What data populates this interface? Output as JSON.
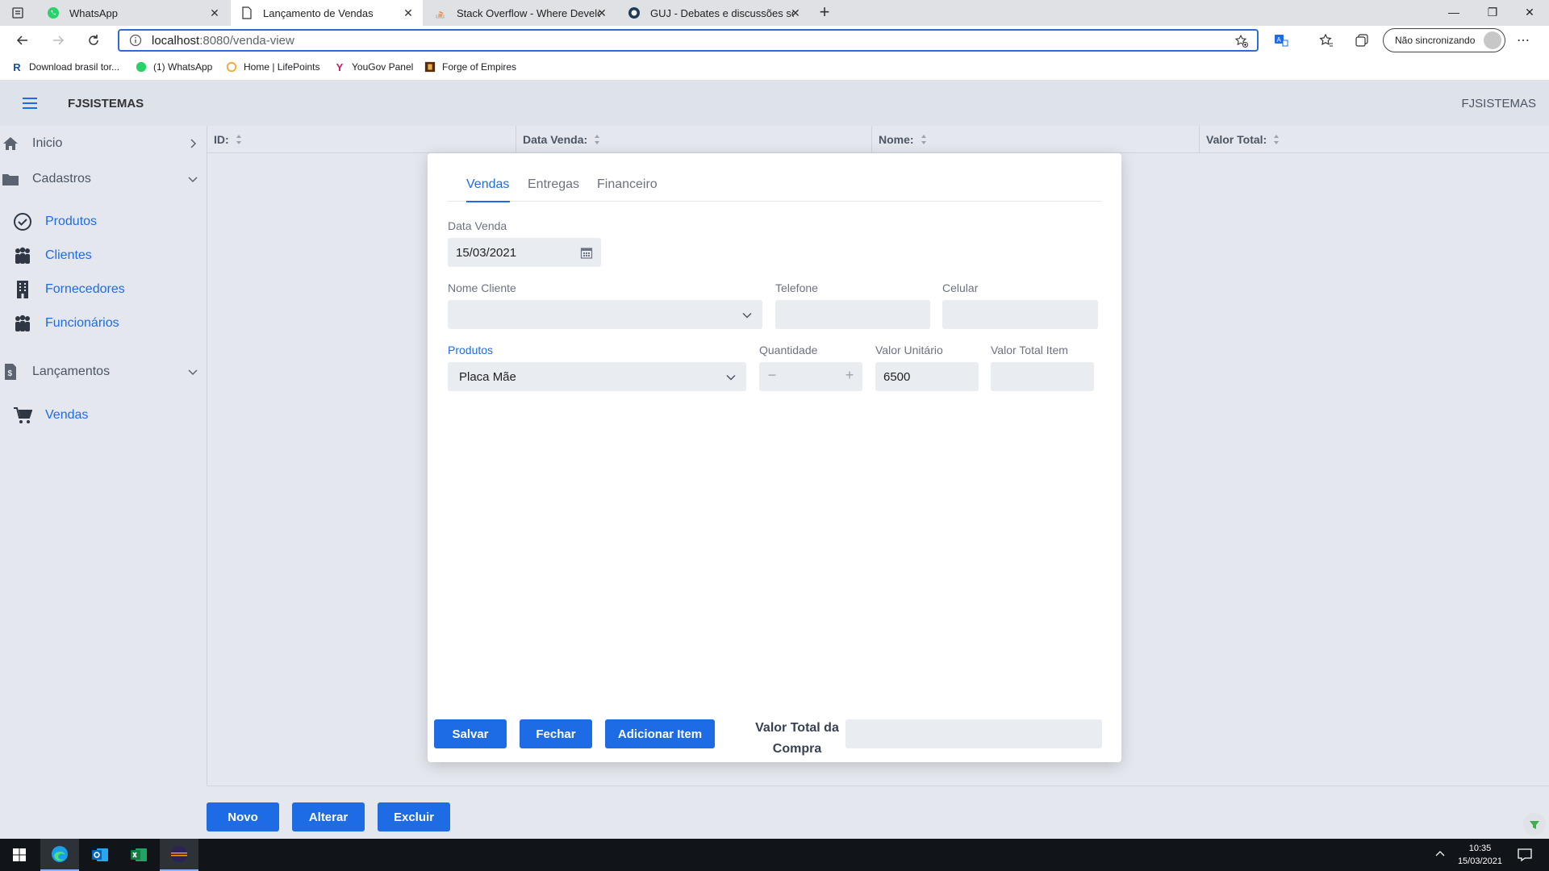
{
  "browser": {
    "tabs": [
      {
        "title": "WhatsApp",
        "active": false
      },
      {
        "title": "Lançamento de Vendas",
        "active": true
      },
      {
        "title": "Stack Overflow - Where Developer",
        "active": false
      },
      {
        "title": "GUJ - Debates e discussões sobre",
        "active": false
      }
    ],
    "url_host": "localhost",
    "url_path": ":8080/venda-view",
    "sync_label": "Não sincronizando",
    "bookmarks": [
      {
        "label": "Download brasil tor..."
      },
      {
        "label": "(1) WhatsApp"
      },
      {
        "label": "Home | LifePoints"
      },
      {
        "label": "YouGov Panel"
      },
      {
        "label": "Forge of Empires"
      }
    ]
  },
  "header": {
    "brand": "FJSISTEMAS",
    "brand_right": "FJSISTEMAS"
  },
  "sidebar": {
    "menus": [
      {
        "label": "Inicio"
      },
      {
        "label": "Cadastros"
      },
      {
        "label": "Lançamentos"
      }
    ],
    "cadastros_items": [
      {
        "label": "Produtos"
      },
      {
        "label": "Clientes"
      },
      {
        "label": "Fornecedores"
      },
      {
        "label": "Funcionários"
      }
    ],
    "lancamentos_items": [
      {
        "label": "Vendas"
      }
    ]
  },
  "table": {
    "columns": [
      {
        "label": "ID:"
      },
      {
        "label": "Data Venda:"
      },
      {
        "label": "Nome:"
      },
      {
        "label": "Valor Total:"
      }
    ]
  },
  "footer_buttons": {
    "novo": "Novo",
    "alterar": "Alterar",
    "excluir": "Excluir"
  },
  "dialog": {
    "tabs": [
      {
        "label": "Vendas",
        "active": true
      },
      {
        "label": "Entregas",
        "active": false
      },
      {
        "label": "Financeiro",
        "active": false
      }
    ],
    "data_venda": {
      "label": "Data Venda",
      "value": "15/03/2021"
    },
    "nome_cliente": {
      "label": "Nome Cliente",
      "value": ""
    },
    "telefone": {
      "label": "Telefone",
      "value": ""
    },
    "celular": {
      "label": "Celular",
      "value": ""
    },
    "produtos": {
      "label": "Produtos",
      "value": "Placa Mãe"
    },
    "quantidade": {
      "label": "Quantidade",
      "value": ""
    },
    "valor_unitario": {
      "label": "Valor Unitário",
      "value": "6500"
    },
    "valor_total_item": {
      "label": "Valor Total Item",
      "value": ""
    },
    "buttons": {
      "salvar": "Salvar",
      "fechar": "Fechar",
      "adicionar": "Adicionar Item"
    },
    "valor_total_compra": {
      "label": "Valor Total da Compra",
      "value": ""
    }
  },
  "taskbar": {
    "time": "10:35",
    "date": "15/03/2021"
  },
  "colors": {
    "primary": "#1e6be6",
    "background": "#e4e8ee",
    "input": "#e9edf2"
  }
}
